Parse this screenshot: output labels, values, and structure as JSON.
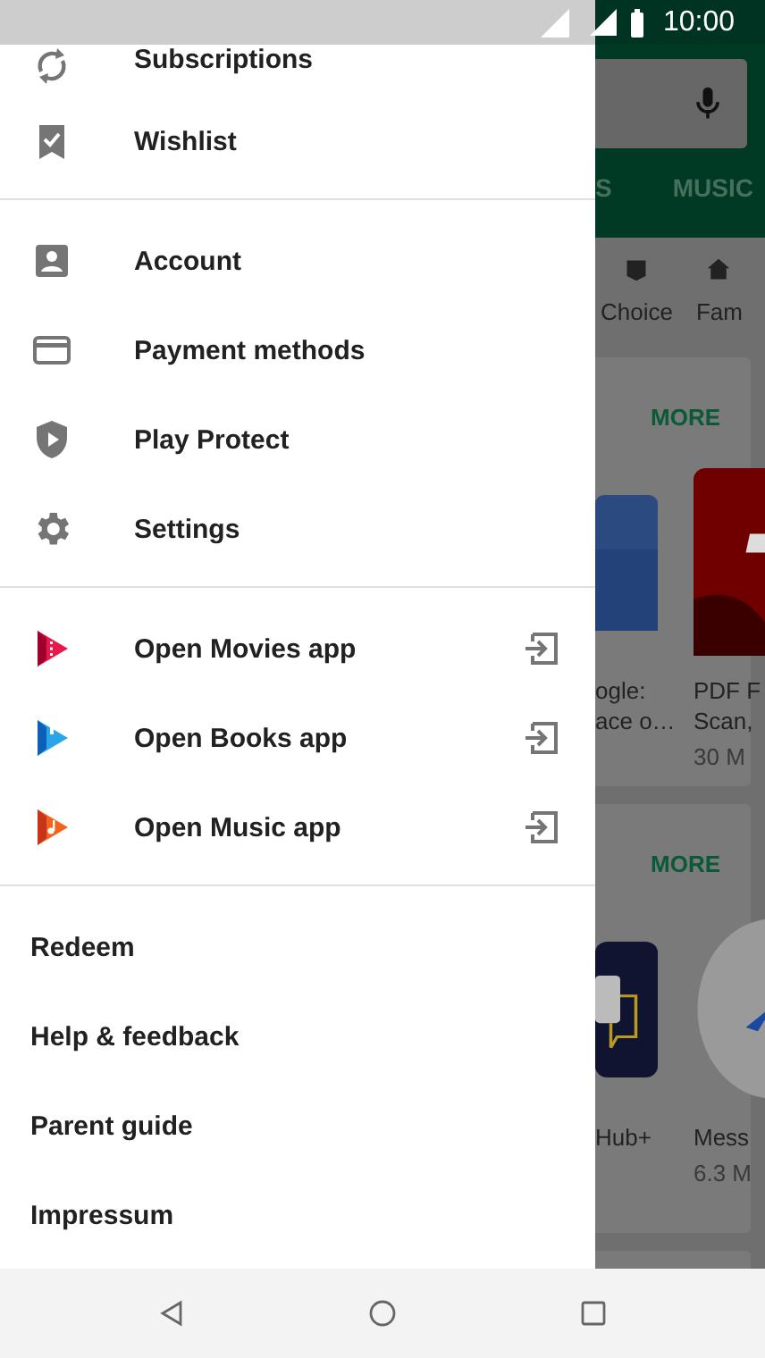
{
  "status_bar": {
    "time": "10:00"
  },
  "drawer": {
    "sections": [
      {
        "items": [
          {
            "kind": "nav",
            "label": "Subscriptions"
          },
          {
            "kind": "nav",
            "label": "Wishlist"
          }
        ]
      },
      {
        "items": [
          {
            "kind": "nav",
            "label": "Account"
          },
          {
            "kind": "nav",
            "label": "Payment methods"
          },
          {
            "kind": "nav",
            "label": "Play Protect"
          },
          {
            "kind": "nav",
            "label": "Settings"
          }
        ]
      },
      {
        "items": [
          {
            "kind": "app",
            "label": "Open Movies app"
          },
          {
            "kind": "app",
            "label": "Open Books app"
          },
          {
            "kind": "app",
            "label": "Open Music app"
          }
        ]
      },
      {
        "items": [
          {
            "kind": "link",
            "label": "Redeem"
          },
          {
            "kind": "link",
            "label": "Help & feedback"
          },
          {
            "kind": "link",
            "label": "Parent guide"
          },
          {
            "kind": "link",
            "label": "Impressum"
          }
        ]
      }
    ]
  },
  "background_screen": {
    "tabs": [
      "S",
      "MUSIC"
    ],
    "chips": [
      "Choice",
      "Fam"
    ],
    "cards": [
      {
        "more": "MORE",
        "apps": [
          {
            "title_lines": [
              "ogle:",
              "ace o…"
            ]
          },
          {
            "title_lines": [
              "PDF F",
              "Scan,"
            ],
            "size": "30 M"
          }
        ]
      },
      {
        "more": "MORE",
        "apps": [
          {
            "title_lines": [
              "Hub+"
            ]
          },
          {
            "title_lines": [
              "Mess"
            ],
            "size": "6.3 M"
          }
        ]
      }
    ]
  }
}
